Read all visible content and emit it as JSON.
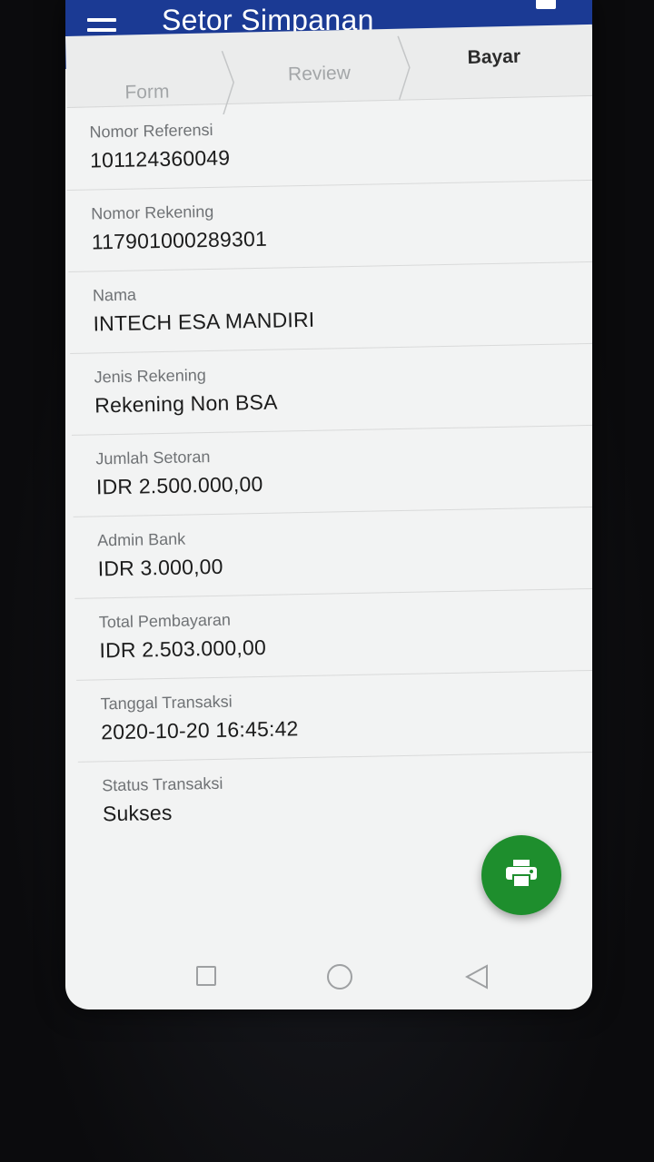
{
  "app": {
    "title": "Setor Simpanan"
  },
  "stepper": {
    "steps": [
      {
        "label": "Form"
      },
      {
        "label": "Review"
      },
      {
        "label": "Bayar"
      }
    ],
    "active": "Bayar"
  },
  "details": [
    {
      "label": "Nomor Referensi",
      "value": "101124360049"
    },
    {
      "label": "Nomor Rekening",
      "value": "117901000289301"
    },
    {
      "label": "Nama",
      "value": "INTECH ESA MANDIRI"
    },
    {
      "label": "Jenis Rekening",
      "value": "Rekening Non BSA"
    },
    {
      "label": "Jumlah Setoran",
      "value": "IDR 2.500.000,00"
    },
    {
      "label": "Admin Bank",
      "value": "IDR 3.000,00"
    },
    {
      "label": "Total Pembayaran",
      "value": "IDR 2.503.000,00"
    },
    {
      "label": "Tanggal Transaksi",
      "value": "2020-10-20 16:45:42"
    },
    {
      "label": "Status Transaksi",
      "value": "Sukses"
    }
  ],
  "fab": {
    "icon": "print-icon",
    "color": "#1e8e2d"
  },
  "colors": {
    "app_bar": "#1b3a94",
    "background": "#f2f3f3"
  },
  "navbar": {
    "icons": [
      "recent-apps-icon",
      "home-icon",
      "back-icon"
    ]
  }
}
